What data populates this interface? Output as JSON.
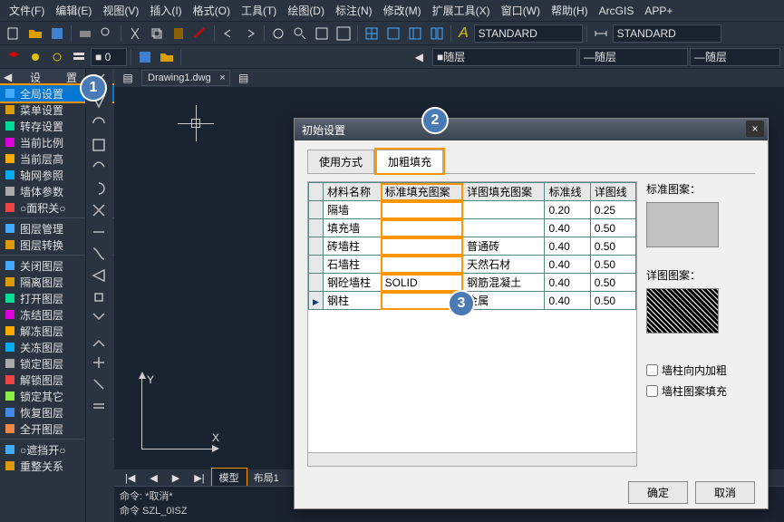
{
  "menubar": [
    "文件(F)",
    "编辑(E)",
    "视图(V)",
    "插入(I)",
    "格式(O)",
    "工具(T)",
    "绘图(D)",
    "标注(N)",
    "修改(M)",
    "扩展工具(X)",
    "窗口(W)",
    "帮助(H)",
    "ArcGIS",
    "APP+"
  ],
  "toolbar_styles": {
    "text_style": "STANDARD",
    "dim_style": "STANDARD"
  },
  "layer_row": {
    "bylayer1": "随层",
    "bylayer2": "随层",
    "bylayer3": "随层"
  },
  "panel_title": "设　置",
  "panel_items_1": [
    "全局设置",
    "菜单设置",
    "转存设置",
    "当前比例",
    "当前层高",
    "轴网参照",
    "墙体参数",
    "○面积关○"
  ],
  "panel_items_2": [
    "图层管理",
    "图层转换"
  ],
  "panel_items_3": [
    "关闭图层",
    "隔离图层",
    "打开图层",
    "冻结图层",
    "解冻图层",
    "关冻图层",
    "锁定图层",
    "解锁图层",
    "锁定其它",
    "恢复图层",
    "全开图层"
  ],
  "panel_items_4": [
    "○遮挡开○",
    "重整关系"
  ],
  "doc_tab": "Drawing1.dwg",
  "axes": {
    "y": "Y",
    "x": "X"
  },
  "bottom_tabs": {
    "nav": [
      "|◀",
      "◀",
      "▶",
      "▶|"
    ],
    "model": "模型",
    "layout": "布局1"
  },
  "cmdline": {
    "line1": "命令: *取消*",
    "line2": "命令 SZL_0ISZ"
  },
  "dialog": {
    "title": "初始设置",
    "tabs": [
      "使用方式",
      "加粗填充"
    ],
    "active_tab": 1,
    "columns": [
      "材料名称",
      "标准填充图案",
      "详图填充图案",
      "标准线",
      "详图线"
    ],
    "rows": [
      {
        "name": "隔墙",
        "std": "",
        "detail": "",
        "sw": "0.20",
        "dw": "0.25"
      },
      {
        "name": "填充墙",
        "std": "",
        "detail": "",
        "sw": "0.40",
        "dw": "0.50"
      },
      {
        "name": "砖墙柱",
        "std": "",
        "detail": "普通砖",
        "sw": "0.40",
        "dw": "0.50"
      },
      {
        "name": "石墙柱",
        "std": "",
        "detail": "天然石材",
        "sw": "0.40",
        "dw": "0.50"
      },
      {
        "name": "钢砼墙柱",
        "std": "SOLID",
        "detail": "钢筋混凝土",
        "sw": "0.40",
        "dw": "0.50"
      },
      {
        "name": "钢柱",
        "std": "",
        "detail": "金属",
        "sw": "0.40",
        "dw": "0.50"
      }
    ],
    "active_row": 5,
    "right": {
      "std_label": "标准图案：",
      "detail_label": "详图图案：",
      "cb1": "墙柱向内加粗",
      "cb2": "墙柱图案填充"
    },
    "buttons": {
      "ok": "确定",
      "cancel": "取消"
    }
  },
  "badges": {
    "b1": "1",
    "b2": "2",
    "b3": "3"
  }
}
